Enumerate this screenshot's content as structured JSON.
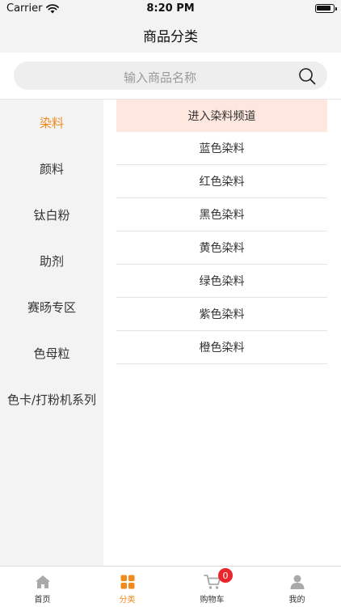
{
  "status_bar": {
    "carrier": "Carrier",
    "time": "8:20 PM"
  },
  "nav": {
    "title": "商品分类"
  },
  "search": {
    "placeholder": "输入商品名称"
  },
  "sidebar": {
    "items": [
      {
        "label": "染料",
        "active": true
      },
      {
        "label": "颜料",
        "active": false
      },
      {
        "label": "钛白粉",
        "active": false
      },
      {
        "label": "助剂",
        "active": false
      },
      {
        "label": "赛旸专区",
        "active": false
      },
      {
        "label": "色母粒",
        "active": false
      },
      {
        "label": "色卡/打粉机系列",
        "active": false
      }
    ]
  },
  "content": {
    "channel_label": "进入染料频道",
    "subcategories": [
      "蓝色染料",
      "红色染料",
      "黑色染料",
      "黄色染料",
      "绿色染料",
      "紫色染料",
      "橙色染料"
    ]
  },
  "tab_bar": {
    "tabs": [
      {
        "label": "首页",
        "icon": "home-icon"
      },
      {
        "label": "分类",
        "icon": "grid-icon"
      },
      {
        "label": "购物车",
        "icon": "cart-icon",
        "badge": "0"
      },
      {
        "label": "我的",
        "icon": "user-icon"
      }
    ],
    "active_index": 1
  },
  "colors": {
    "accent": "#f08a1c",
    "badge": "#e8262b",
    "highlight_bg": "#fde7de"
  }
}
